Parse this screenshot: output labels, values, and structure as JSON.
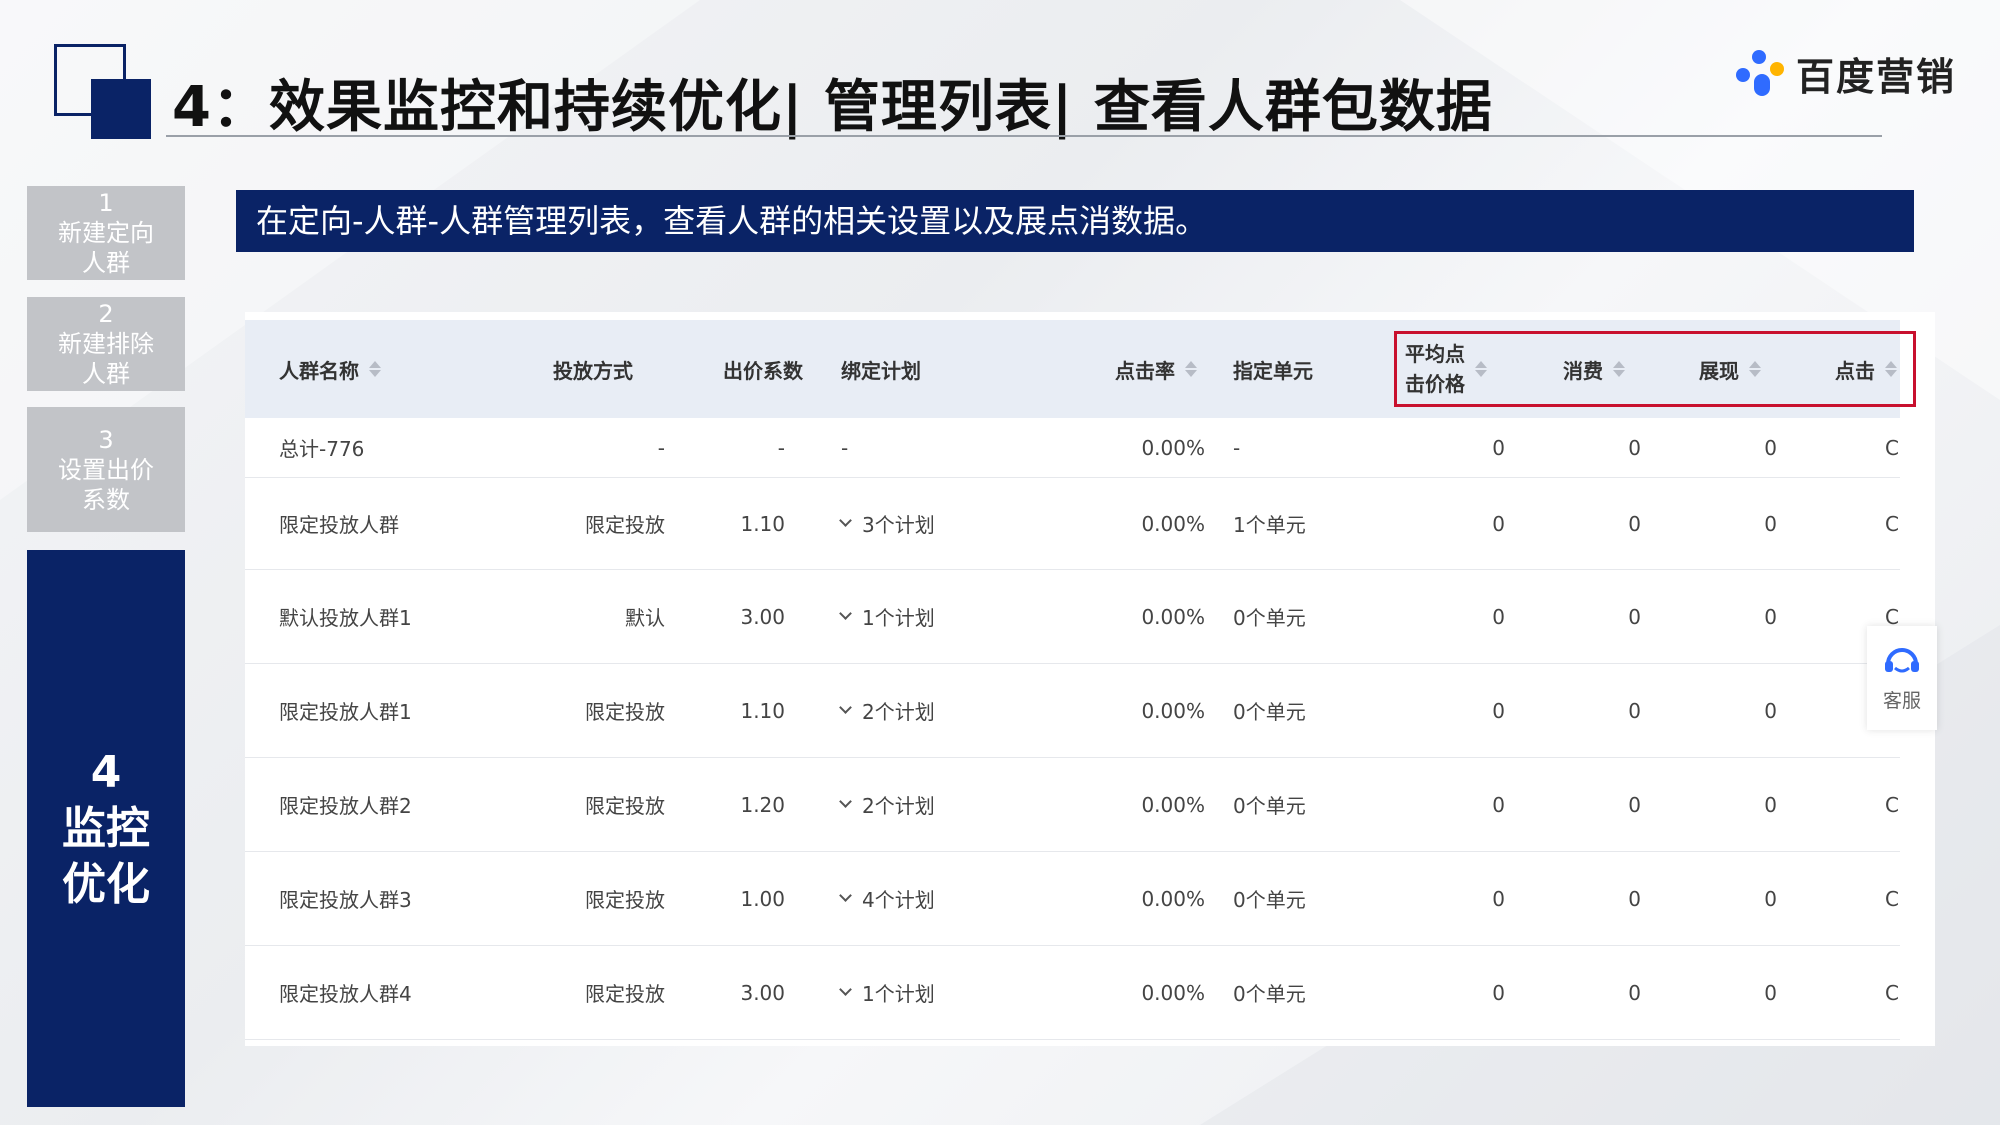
{
  "header": {
    "title": "4：效果监控和持续优化| 管理列表| 查看人群包数据",
    "brand": "百度营销"
  },
  "colors": {
    "navy": "#0a2366",
    "step_gray": "#c2c4c8",
    "highlight_red": "#c8102e",
    "table_header_bg": "#e8edf5"
  },
  "steps": [
    {
      "num": "1",
      "label": "新建定向\n人群"
    },
    {
      "num": "2",
      "label": "新建排除\n人群"
    },
    {
      "num": "3",
      "label": "设置出价\n系数"
    },
    {
      "num": "4",
      "label": "监控\n优化"
    }
  ],
  "banner": "在定向-人群-人群管理列表，查看人群的相关设置以及展点消数据。",
  "table": {
    "columns": {
      "name": "人群名称",
      "mode": "投放方式",
      "bid": "出价系数",
      "plan": "绑定计划",
      "ctr": "点击率",
      "unit": "指定单元",
      "avg_cpc": "平均点\n击价格",
      "cost": "消费",
      "impressions": "展现",
      "clicks": "点击"
    },
    "rows": [
      {
        "name": "总计-776",
        "mode": "-",
        "bid": "-",
        "plan": "-",
        "ctr": "0.00%",
        "unit": "-",
        "avg_cpc": "0",
        "cost": "0",
        "impressions": "0",
        "clicks": "C",
        "plan_expand": false
      },
      {
        "name": "限定投放人群",
        "mode": "限定投放",
        "bid": "1.10",
        "plan": "3个计划",
        "ctr": "0.00%",
        "unit": "1个单元",
        "avg_cpc": "0",
        "cost": "0",
        "impressions": "0",
        "clicks": "C",
        "plan_expand": true
      },
      {
        "name": "默认投放人群1",
        "mode": "默认",
        "bid": "3.00",
        "plan": "1个计划",
        "ctr": "0.00%",
        "unit": "0个单元",
        "avg_cpc": "0",
        "cost": "0",
        "impressions": "0",
        "clicks": "C",
        "plan_expand": true
      },
      {
        "name": "限定投放人群1",
        "mode": "限定投放",
        "bid": "1.10",
        "plan": "2个计划",
        "ctr": "0.00%",
        "unit": "0个单元",
        "avg_cpc": "0",
        "cost": "0",
        "impressions": "0",
        "clicks": "",
        "plan_expand": true
      },
      {
        "name": "限定投放人群2",
        "mode": "限定投放",
        "bid": "1.20",
        "plan": "2个计划",
        "ctr": "0.00%",
        "unit": "0个单元",
        "avg_cpc": "0",
        "cost": "0",
        "impressions": "0",
        "clicks": "C",
        "plan_expand": true
      },
      {
        "name": "限定投放人群3",
        "mode": "限定投放",
        "bid": "1.00",
        "plan": "4个计划",
        "ctr": "0.00%",
        "unit": "0个单元",
        "avg_cpc": "0",
        "cost": "0",
        "impressions": "0",
        "clicks": "C",
        "plan_expand": true
      },
      {
        "name": "限定投放人群4",
        "mode": "限定投放",
        "bid": "3.00",
        "plan": "1个计划",
        "ctr": "0.00%",
        "unit": "0个单元",
        "avg_cpc": "0",
        "cost": "0",
        "impressions": "0",
        "clicks": "C",
        "plan_expand": true
      }
    ]
  },
  "service": {
    "label": "客服",
    "icon": "headset-icon"
  }
}
